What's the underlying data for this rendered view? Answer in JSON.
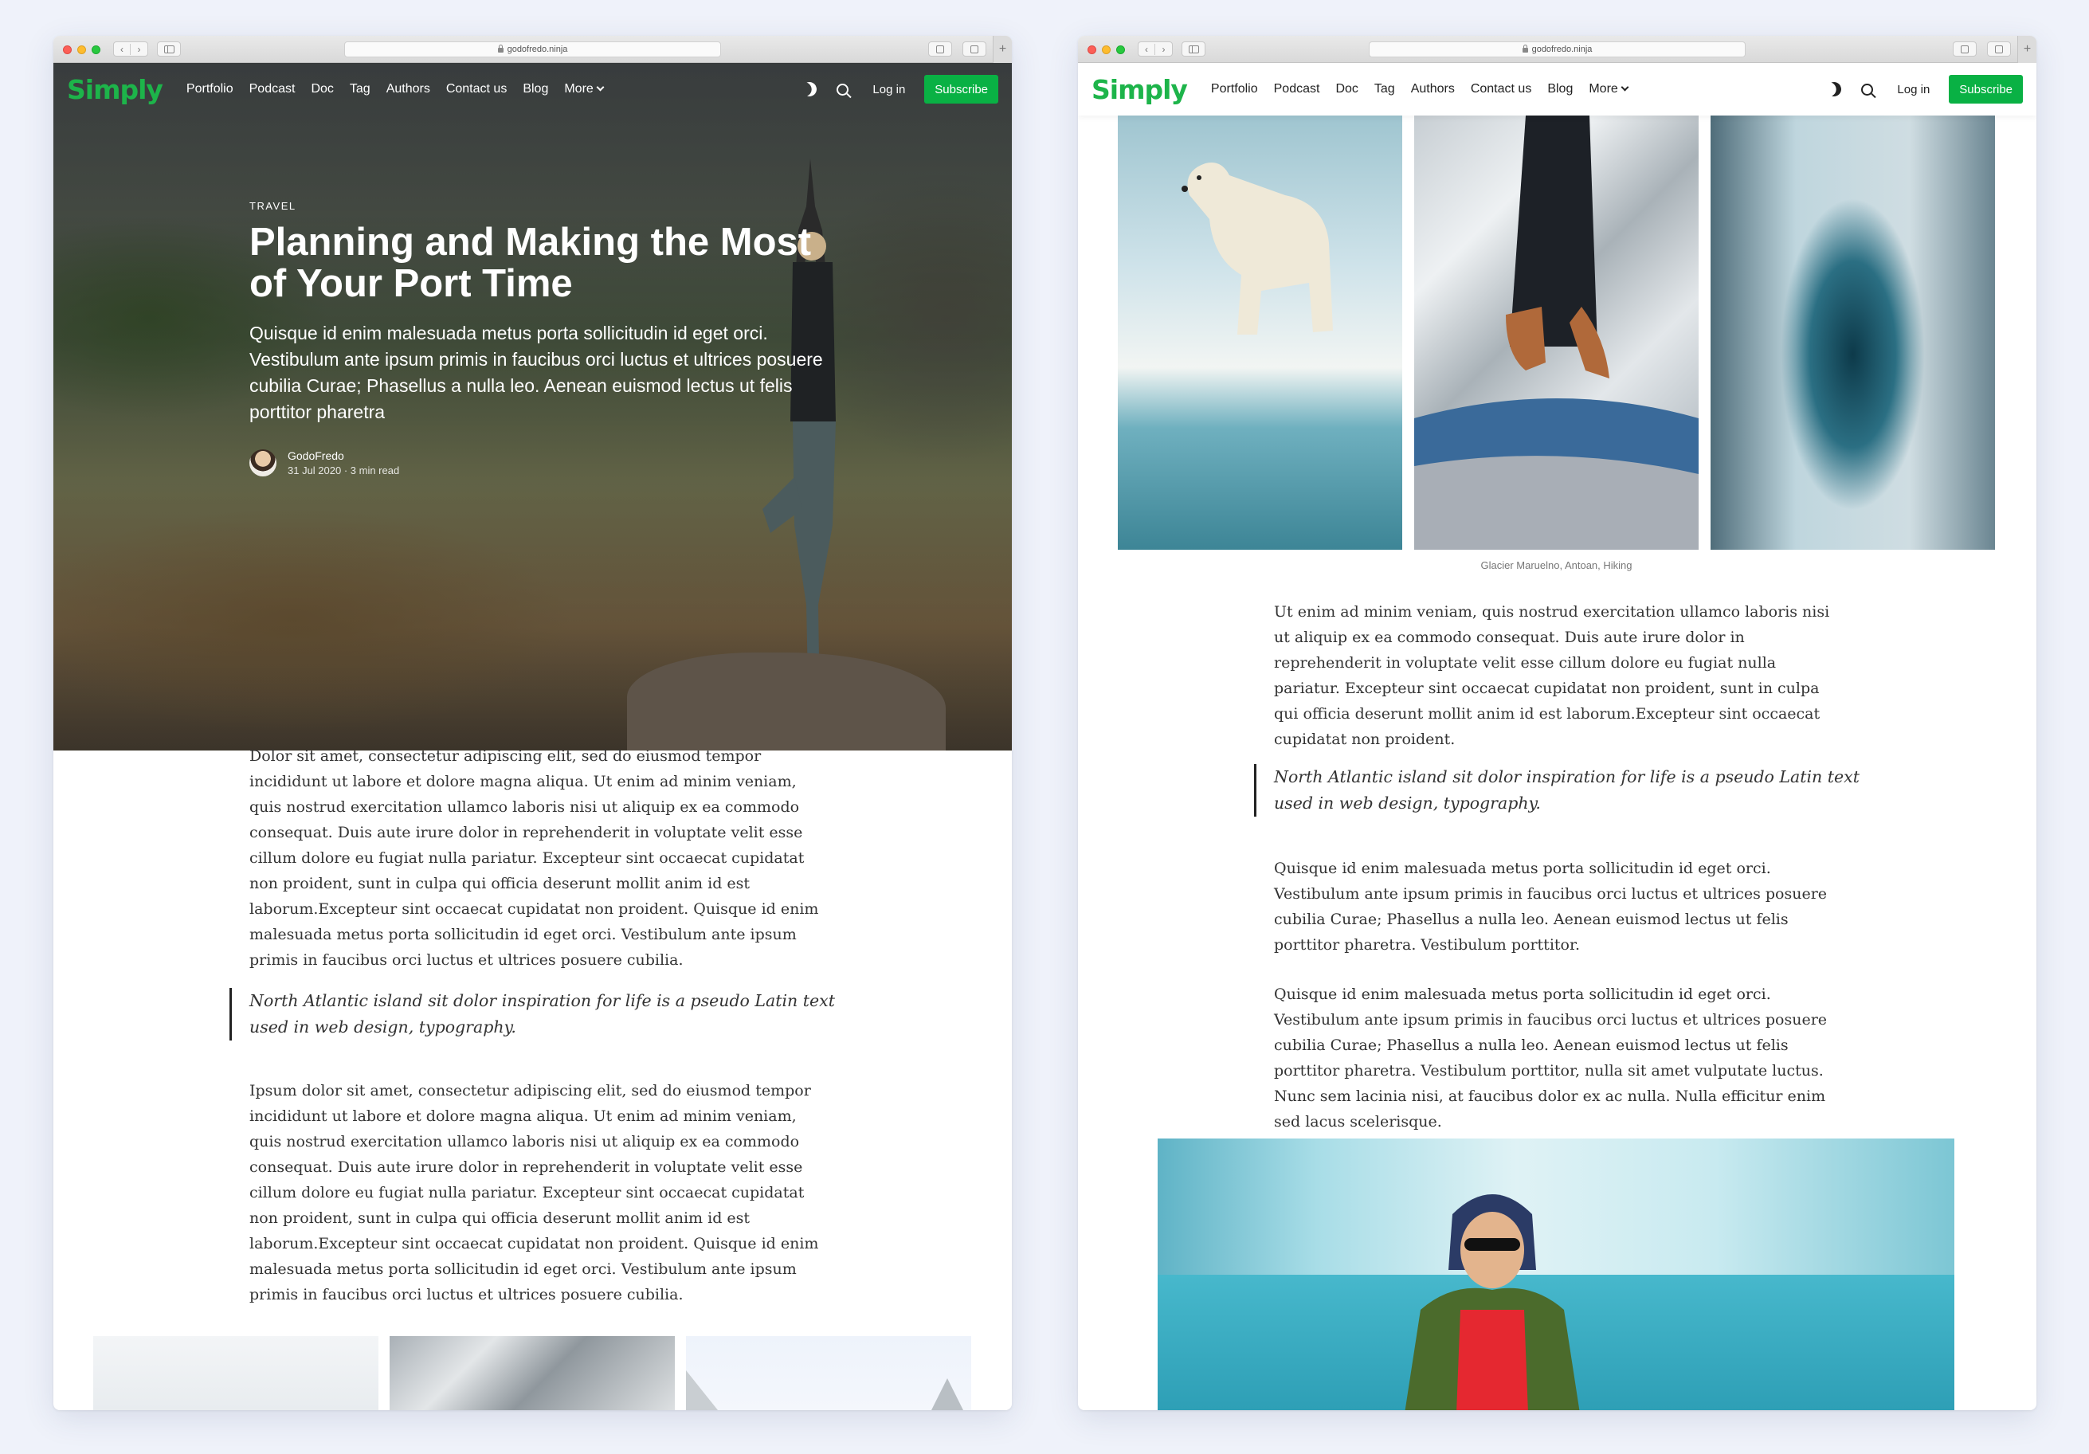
{
  "browser": {
    "url": "godofredo.ninja",
    "back": "‹",
    "forward": "›",
    "new_tab": "+"
  },
  "site": {
    "logo": "Simply",
    "nav": [
      "Portfolio",
      "Podcast",
      "Doc",
      "Tag",
      "Authors",
      "Contact us",
      "Blog",
      "More"
    ],
    "login": "Log in",
    "subscribe": "Subscribe",
    "accent_color": "#09b144"
  },
  "left": {
    "category": "TRAVEL",
    "title": "Planning and Making the Most of Your Port Time",
    "subtitle": "Quisque id enim malesuada metus porta sollicitudin id eget orci. Vestibulum ante ipsum primis in faucibus orci luctus et ultrices posuere cubilia Curae; Phasellus a nulla leo. Aenean euismod lectus ut felis porttitor pharetra",
    "author": "GodoFredo",
    "meta": "31 Jul 2020 · 3 min read",
    "para1": "Dolor sit amet, consectetur adipiscing elit, sed do eiusmod tempor incididunt ut labore et dolore magna aliqua. Ut enim ad minim veniam, quis nostrud exercitation ullamco laboris nisi ut aliquip ex ea commodo consequat. Duis aute irure dolor in reprehenderit in voluptate velit esse cillum dolore eu fugiat nulla pariatur. Excepteur sint occaecat cupidatat non proident, sunt in culpa qui officia deserunt mollit anim id est laborum.Excepteur sint occaecat cupidatat non proident. Quisque id enim malesuada metus porta sollicitudin id eget orci. Vestibulum ante ipsum primis in faucibus orci luctus et ultrices posuere cubilia.",
    "quote": "North Atlantic island sit dolor inspiration for life is a pseudo Latin text used in web design, typography.",
    "para2": "Ipsum dolor sit amet, consectetur adipiscing elit, sed do eiusmod tempor incididunt ut labore et dolore magna aliqua. Ut enim ad minim veniam, quis nostrud exercitation ullamco laboris nisi ut aliquip ex ea commodo consequat. Duis aute irure dolor in reprehenderit in voluptate velit esse cillum dolore eu fugiat nulla pariatur. Excepteur sint occaecat cupidatat non proident, sunt in culpa qui officia deserunt mollit anim id est laborum.Excepteur sint occaecat cupidatat non proident. Quisque id enim malesuada metus porta sollicitudin id eget orci. Vestibulum ante ipsum primis in faucibus orci luctus et ultrices posuere cubilia."
  },
  "right": {
    "caption": "Glacier Maruelno, Antoan, Hiking",
    "para1": "Ut enim ad minim veniam, quis nostrud exercitation ullamco laboris nisi ut aliquip ex ea commodo consequat. Duis aute irure dolor in reprehenderit in voluptate velit esse cillum dolore eu fugiat nulla pariatur. Excepteur sint occaecat cupidatat non proident, sunt in culpa qui officia deserunt mollit anim id est laborum.Excepteur sint occaecat cupidatat non proident.",
    "quote": "North Atlantic island sit dolor inspiration for life is a pseudo Latin text used in web design, typography.",
    "para2": "Quisque id enim malesuada metus porta sollicitudin id eget orci. Vestibulum ante ipsum primis in faucibus orci luctus et ultrices posuere cubilia Curae; Phasellus a nulla leo. Aenean euismod lectus ut felis porttitor pharetra. Vestibulum porttitor.",
    "para3": "Quisque id enim malesuada metus porta sollicitudin id eget orci. Vestibulum ante ipsum primis in faucibus orci luctus et ultrices posuere cubilia Curae; Phasellus a nulla leo. Aenean euismod lectus ut felis porttitor pharetra. Vestibulum porttitor, nulla sit amet vulputate luctus. Nunc sem lacinia nisi, at faucibus dolor ex ac nulla. Nulla efficitur enim sed lacus scelerisque."
  }
}
